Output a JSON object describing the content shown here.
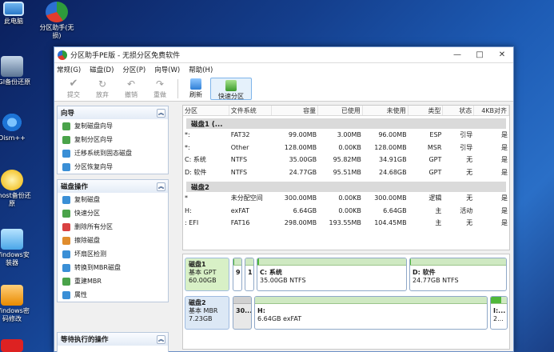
{
  "desktop": {
    "icons": [
      "此电脑",
      "分区助手(无损)",
      "CGI备份还原",
      "Dism++",
      "Ghost备份还原",
      "Windows安装器",
      "Windows密码修改"
    ]
  },
  "window": {
    "title": "分区助手PE版 - 无损分区免费软件",
    "controls": {
      "min": "—",
      "max": "□",
      "close": "✕"
    }
  },
  "menu": [
    "常规(G)",
    "磁盘(D)",
    "分区(P)",
    "向导(W)",
    "帮助(H)"
  ],
  "toolbar": {
    "submit": "提交",
    "discard": "放弃",
    "undo": "撤销",
    "redo": "重做",
    "refresh": "刷新",
    "quick_partition": "快速分区"
  },
  "left": {
    "wizard": {
      "title": "向导",
      "items": [
        "复制磁盘向导",
        "复制分区向导",
        "迁移系统到固态磁盘",
        "分区恢复向导"
      ]
    },
    "disk_ops": {
      "title": "磁盘操作",
      "items": [
        "复制磁盘",
        "快速分区",
        "删除所有分区",
        "擦除磁盘",
        "坏扇区检测",
        "转换到MBR磁盘",
        "重建MBR",
        "属性"
      ]
    },
    "pending": {
      "title": "等待执行的操作"
    }
  },
  "table": {
    "headers": [
      "分区",
      "文件系统",
      "容量",
      "已使用",
      "未使用",
      "类型",
      "状态",
      "4KB对齐"
    ],
    "disks": [
      {
        "name": "磁盘1 (...",
        "rows": [
          [
            "*:",
            "FAT32",
            "99.00MB",
            "3.00MB",
            "96.00MB",
            "ESP",
            "引导",
            "是"
          ],
          [
            "*:",
            "Other",
            "128.00MB",
            "0.00KB",
            "128.00MB",
            "MSR",
            "引导",
            "是"
          ],
          [
            "C: 系统",
            "NTFS",
            "35.00GB",
            "95.82MB",
            "34.91GB",
            "GPT",
            "无",
            "是"
          ],
          [
            "D: 软件",
            "NTFS",
            "24.77GB",
            "95.51MB",
            "24.68GB",
            "GPT",
            "无",
            "是"
          ]
        ]
      },
      {
        "name": "磁盘2",
        "rows": [
          [
            "*",
            "未分配空间",
            "300.00MB",
            "0.00KB",
            "300.00MB",
            "逻辑",
            "无",
            "是"
          ],
          [
            "H:",
            "exFAT",
            "6.64GB",
            "0.00KB",
            "6.64GB",
            "主",
            "活动",
            "是"
          ],
          [
            ": EFI",
            "FAT16",
            "298.00MB",
            "193.55MB",
            "104.45MB",
            "主",
            "无",
            "是"
          ]
        ]
      }
    ]
  },
  "map": {
    "disk1": {
      "name": "磁盘1",
      "type": "基本 GPT",
      "size": "60.00GB",
      "segs": [
        {
          "line1": "9",
          "line2": "",
          "fill": 0.05
        },
        {
          "line1": "1",
          "line2": "",
          "fill": 0.0
        },
        {
          "line1": "C: 系统",
          "line2": "35.00GB NTFS",
          "fill": 0.01
        },
        {
          "line1": "D: 软件",
          "line2": "24.77GB NTFS",
          "fill": 0.01
        }
      ]
    },
    "disk2": {
      "name": "磁盘2",
      "type": "基本 MBR",
      "size": "7.23GB",
      "segs": [
        {
          "line1": "30...",
          "line2": "",
          "fill": 0.0
        },
        {
          "line1": "H:",
          "line2": "6.64GB exFAT",
          "fill": 0.0
        },
        {
          "line1": "I:...",
          "line2": "2...",
          "fill": 0.65
        }
      ]
    }
  }
}
